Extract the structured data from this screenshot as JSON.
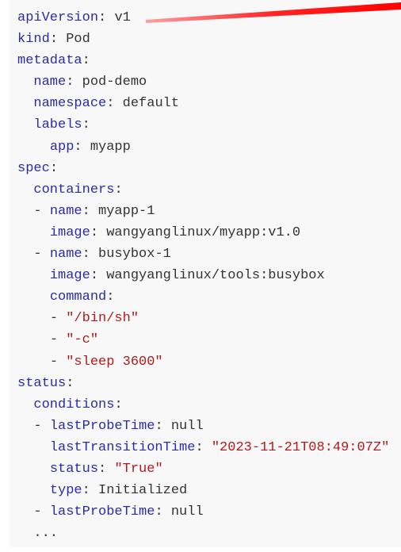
{
  "code": {
    "lines": [
      {
        "indent": "",
        "dash": "",
        "key": "apiVersion",
        "value": "v1",
        "type": "plain"
      },
      {
        "indent": "",
        "dash": "",
        "key": "kind",
        "value": "Pod",
        "type": "plain"
      },
      {
        "indent": "",
        "dash": "",
        "key": "metadata",
        "value": "",
        "type": "plain"
      },
      {
        "indent": "  ",
        "dash": "",
        "key": "name",
        "value": "pod-demo",
        "type": "plain"
      },
      {
        "indent": "  ",
        "dash": "",
        "key": "namespace",
        "value": "default",
        "type": "plain"
      },
      {
        "indent": "  ",
        "dash": "",
        "key": "labels",
        "value": "",
        "type": "plain"
      },
      {
        "indent": "    ",
        "dash": "",
        "key": "app",
        "value": "myapp",
        "type": "plain"
      },
      {
        "indent": "",
        "dash": "",
        "key": "spec",
        "value": "",
        "type": "plain"
      },
      {
        "indent": "  ",
        "dash": "",
        "key": "containers",
        "value": "",
        "type": "plain"
      },
      {
        "indent": "  ",
        "dash": "- ",
        "key": "name",
        "value": "myapp-1",
        "type": "plain"
      },
      {
        "indent": "    ",
        "dash": "",
        "key": "image",
        "value": "wangyanglinux/myapp:v1.0",
        "type": "plain"
      },
      {
        "indent": "  ",
        "dash": "- ",
        "key": "name",
        "value": "busybox-1",
        "type": "plain"
      },
      {
        "indent": "    ",
        "dash": "",
        "key": "image",
        "value": "wangyanglinux/tools:busybox",
        "type": "plain"
      },
      {
        "indent": "    ",
        "dash": "",
        "key": "command",
        "value": "",
        "type": "plain"
      },
      {
        "indent": "    ",
        "dash": "- ",
        "key": "",
        "value": "\"/bin/sh\"",
        "type": "string"
      },
      {
        "indent": "    ",
        "dash": "- ",
        "key": "",
        "value": "\"-c\"",
        "type": "string"
      },
      {
        "indent": "    ",
        "dash": "- ",
        "key": "",
        "value": "\"sleep 3600\"",
        "type": "string"
      },
      {
        "indent": "",
        "dash": "",
        "key": "status",
        "value": "",
        "type": "plain"
      },
      {
        "indent": "  ",
        "dash": "",
        "key": "conditions",
        "value": "",
        "type": "plain"
      },
      {
        "indent": "  ",
        "dash": "- ",
        "key": "lastProbeTime",
        "value": "null",
        "type": "plain"
      },
      {
        "indent": "    ",
        "dash": "",
        "key": "lastTransitionTime",
        "value": "\"2023-11-21T08:49:07Z\"",
        "type": "string"
      },
      {
        "indent": "    ",
        "dash": "",
        "key": "status",
        "value": "\"True\"",
        "type": "string"
      },
      {
        "indent": "    ",
        "dash": "",
        "key": "type",
        "value": "Initialized",
        "type": "plain"
      },
      {
        "indent": "  ",
        "dash": "- ",
        "key": "lastProbeTime",
        "value": "null",
        "type": "plain"
      },
      {
        "indent": "  ",
        "dash": "",
        "key": "",
        "value": "...",
        "type": "plain"
      }
    ]
  },
  "colors": {
    "key": "#2b2ba6",
    "string": "#b11a1a",
    "plain": "#333333",
    "annotation": "#ff0000"
  }
}
